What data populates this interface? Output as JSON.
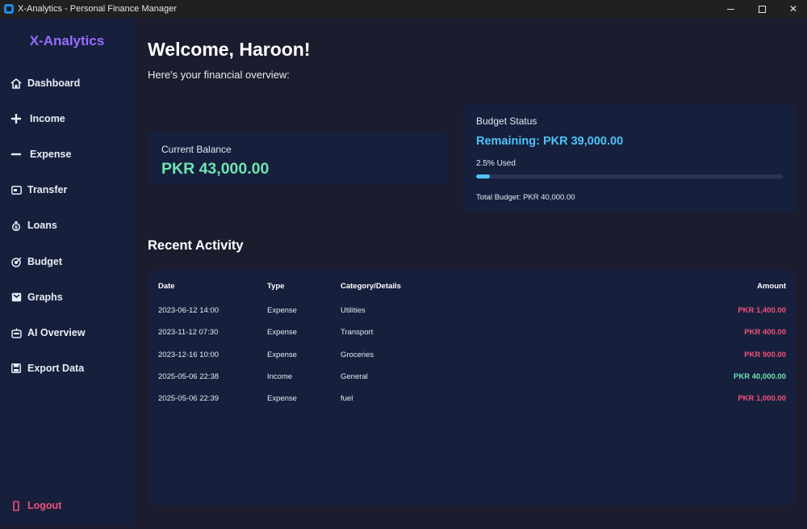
{
  "window": {
    "title": "X-Analytics - Personal Finance Manager"
  },
  "sidebar": {
    "brand": "X-Analytics",
    "items": [
      {
        "label": "Dashboard",
        "icon": "home-icon"
      },
      {
        "label": "Income",
        "icon": "plus-icon"
      },
      {
        "label": "Expense",
        "icon": "minus-icon"
      },
      {
        "label": "Transfer",
        "icon": "card-icon"
      },
      {
        "label": "Loans",
        "icon": "money-bag-icon"
      },
      {
        "label": "Budget",
        "icon": "target-icon"
      },
      {
        "label": "Graphs",
        "icon": "chart-icon"
      },
      {
        "label": "AI Overview",
        "icon": "robot-icon"
      },
      {
        "label": "Export Data",
        "icon": "save-icon"
      }
    ],
    "logout": "Logout"
  },
  "header": {
    "welcome": "Welcome, Haroon!",
    "subtitle": "Here's your financial overview:"
  },
  "balance": {
    "label": "Current Balance",
    "value": "PKR 43,000.00"
  },
  "budget": {
    "label": "Budget Status",
    "remaining": "Remaining: PKR 39,000.00",
    "used": "2.5% Used",
    "used_fraction": 0.025,
    "total": "Total Budget: PKR 40,000.00"
  },
  "activity": {
    "title": "Recent Activity",
    "columns": {
      "date": "Date",
      "type": "Type",
      "category": "Category/Details",
      "amount": "Amount"
    },
    "rows": [
      {
        "date": "2023-06-12 14:00",
        "type": "Expense",
        "category": "Utilities",
        "amount": "PKR 1,400.00"
      },
      {
        "date": "2023-11-12 07:30",
        "type": "Expense",
        "category": "Transport",
        "amount": "PKR 400.00"
      },
      {
        "date": "2023-12-16 10:00",
        "type": "Expense",
        "category": "Groceries",
        "amount": "PKR 900.00"
      },
      {
        "date": "2025-05-06 22:38",
        "type": "Income",
        "category": "General",
        "amount": "PKR 40,000.00"
      },
      {
        "date": "2025-05-06 22:39",
        "type": "Expense",
        "category": "fuel",
        "amount": "PKR 1,000.00"
      }
    ]
  },
  "colors": {
    "accent_purple": "#9b6bff",
    "income_green": "#6fe3b0",
    "expense_red": "#f0507a",
    "budget_blue": "#4fc3f7"
  }
}
